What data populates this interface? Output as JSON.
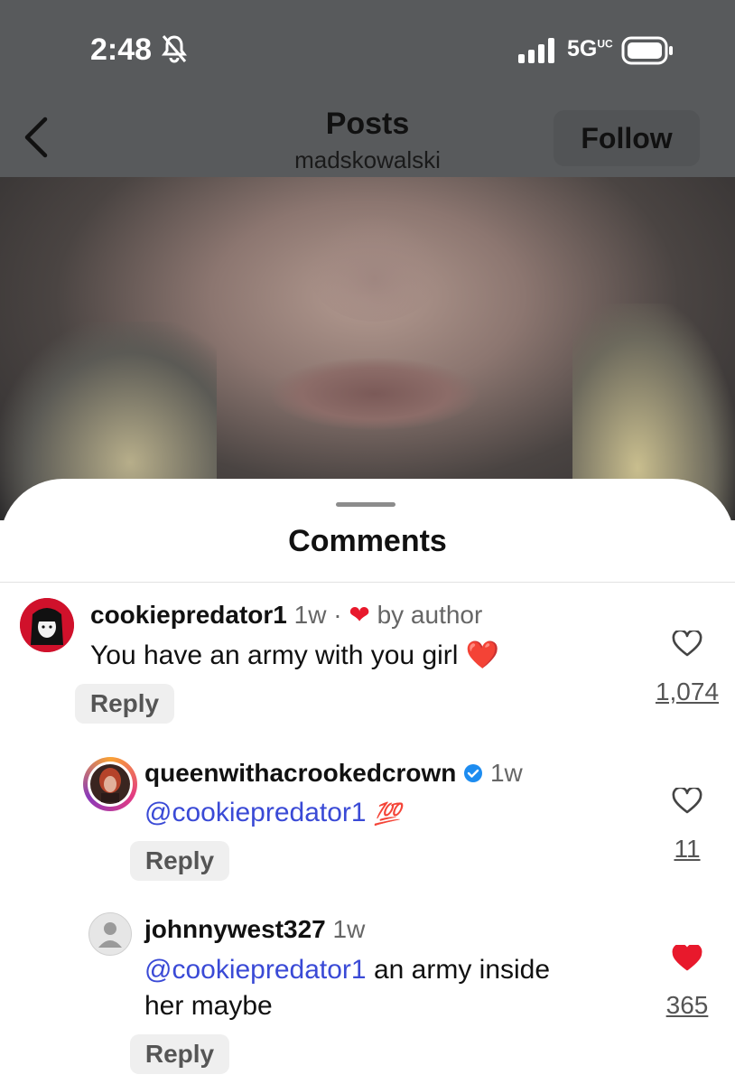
{
  "status_bar": {
    "time": "2:48",
    "network": "5G",
    "network_sup": "UC"
  },
  "header": {
    "title": "Posts",
    "subtitle": "madskowalski",
    "follow_label": "Follow"
  },
  "sheet": {
    "title": "Comments"
  },
  "comments": [
    {
      "username": "cookiepredator1",
      "time": "1w",
      "separator": "·",
      "author_like": "by author",
      "text": "You have an army with you girl",
      "emoji": "❤️",
      "reply_label": "Reply",
      "likes": "1,074",
      "liked": false
    },
    {
      "username": "queenwithacrookedcrown",
      "verified": true,
      "time": "1w",
      "mention": "@cookiepredator1",
      "emoji": "💯",
      "reply_label": "Reply",
      "likes": "11",
      "liked": false
    },
    {
      "username": "johnnywest327",
      "time": "1w",
      "mention": "@cookiepredator1",
      "text_line1": " an army inside",
      "text_line2": "her maybe",
      "reply_label": "Reply",
      "likes": "365",
      "liked": true
    }
  ],
  "colors": {
    "like_red": "#e8192c",
    "mention_blue": "#3a4ad6",
    "header_gray": "#585a5c"
  }
}
